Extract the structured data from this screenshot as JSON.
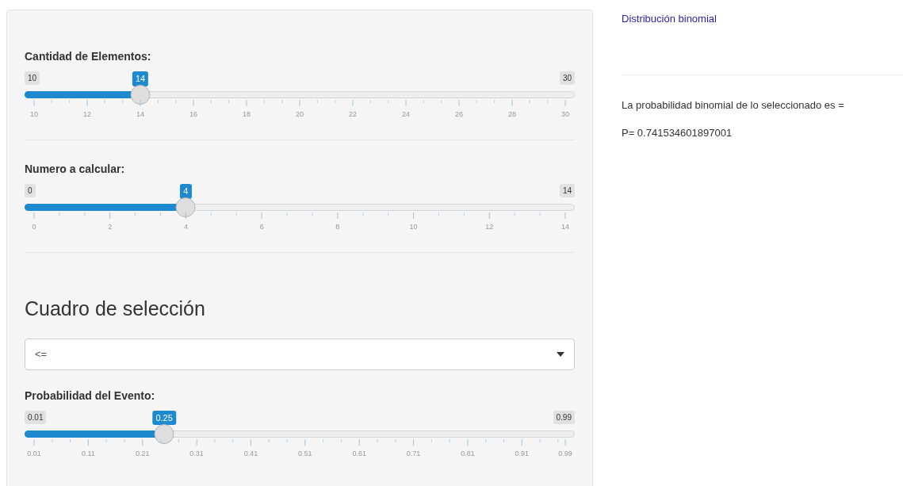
{
  "sidebar": {
    "sliders_top": [
      {
        "label": "Cantidad de Elementos:",
        "min": "10",
        "max": "30",
        "value": "14",
        "level": 0.2,
        "ticks": [
          "10",
          "12",
          "14",
          "16",
          "18",
          "20",
          "22",
          "24",
          "26",
          "28",
          "30"
        ]
      },
      {
        "label": "Numero a calcular:",
        "min": "0",
        "max": "14",
        "value": "4",
        "level": 0.2857,
        "ticks": [
          "0",
          "2",
          "4",
          "6",
          "8",
          "10",
          "12",
          "14"
        ]
      }
    ],
    "select_heading": "Cuadro de selección",
    "select": {
      "value": "<="
    },
    "sliders_bottom": [
      {
        "label": "Probabilidad del Evento:",
        "min": "0.01",
        "max": "0.99",
        "value": "0.25",
        "level": 0.245,
        "ticks": [
          "0.01",
          "0.11",
          "0.21",
          "0.31",
          "0.41",
          "0.51",
          "0.61",
          "0.71",
          "0.81",
          "0.91",
          "0.99"
        ]
      }
    ]
  },
  "main": {
    "title": "Distribución binomial",
    "result_text": "La probabilidad binomial de lo seleccionado es =",
    "result_value": "P= 0.741534601897001"
  }
}
